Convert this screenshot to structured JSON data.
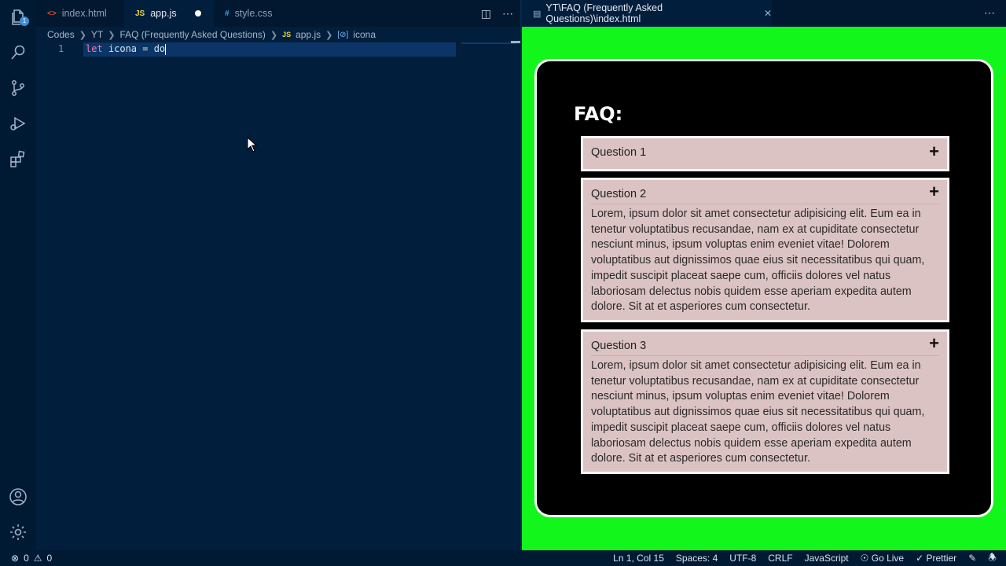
{
  "editor_tabs": [
    {
      "label": "index.html",
      "icon": "<>"
    },
    {
      "label": "app.js",
      "icon": "JS"
    },
    {
      "label": "style.css",
      "icon": "#"
    }
  ],
  "breadcrumb": [
    "Codes",
    "YT",
    "FAQ (Frequently Asked Questions)",
    "app.js",
    "icona"
  ],
  "breadcrumb_icons": {
    "js": "JS",
    "var": "[⊘]"
  },
  "code": {
    "line_number": "1",
    "keyword": "let",
    "rest": " icona = do"
  },
  "preview": {
    "tab_label": "YT\\FAQ (Frequently Asked Questions)\\index.html",
    "faq_title": "FAQ:",
    "questions": [
      {
        "title": "Question 1",
        "answer": ""
      },
      {
        "title": "Question 2",
        "answer": "Lorem, ipsum dolor sit amet consectetur adipisicing elit. Eum ea in tenetur voluptatibus recusandae, nam ex at cupiditate consectetur nesciunt minus, ipsum voluptas enim eveniet vitae! Dolorem voluptatibus aut dignissimos quae eius sit necessitatibus qui quam, impedit suscipit placeat saepe cum, officiis dolores vel natus laboriosam delectus nobis quidem esse aperiam expedita autem dolore. Sit at et asperiores cum consectetur."
      },
      {
        "title": "Question 3",
        "answer": "Lorem, ipsum dolor sit amet consectetur adipisicing elit. Eum ea in tenetur voluptatibus recusandae, nam ex at cupiditate consectetur nesciunt minus, ipsum voluptas enim eveniet vitae! Dolorem voluptatibus aut dignissimos quae eius sit necessitatibus qui quam, impedit suscipit placeat saepe cum, officiis dolores vel natus laboriosam delectus nobis quidem esse aperiam expedita autem dolore. Sit at et asperiores cum consectetur."
      }
    ],
    "plus_symbol": "+"
  },
  "status": {
    "errors": "0",
    "warnings": "0",
    "position": "Ln 1, Col 15",
    "spaces": "Spaces: 4",
    "encoding": "UTF-8",
    "eol": "CRLF",
    "language": "JavaScript",
    "golive": "Go Live",
    "prettier": "Prettier"
  },
  "activity_badge": "1",
  "colors": {
    "editor_bg": "#011e3c",
    "preview_bg": "#13f61c",
    "keyword": "#f07fa5",
    "question_bg": "#dcc3c3"
  },
  "icons": [
    "files-icon",
    "search-icon",
    "source-control-icon",
    "run-debug-icon",
    "extensions-icon",
    "account-icon",
    "settings-gear-icon"
  ]
}
